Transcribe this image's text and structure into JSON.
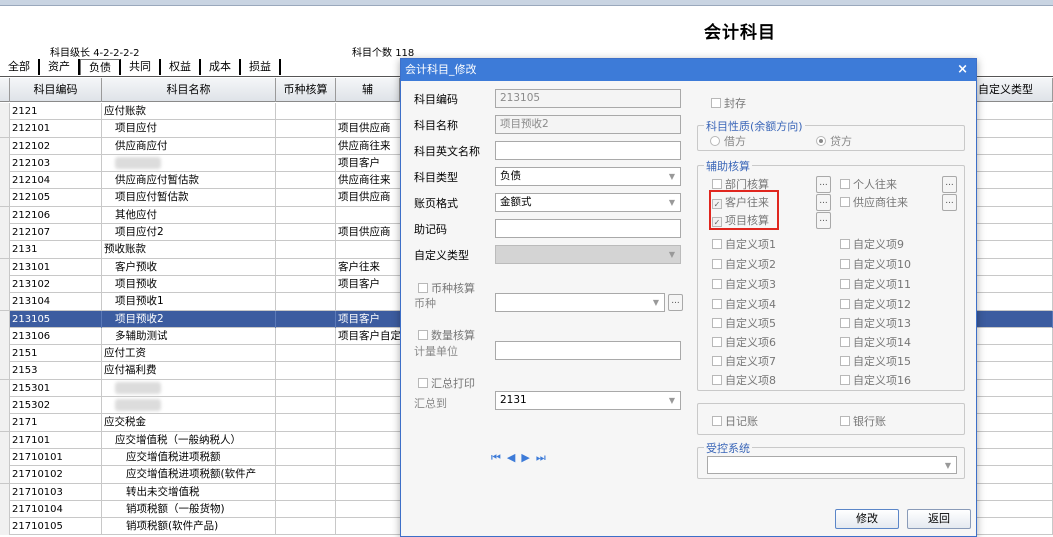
{
  "page": {
    "title": "会计科目",
    "level_label": "科目级长",
    "level_value": "4-2-2-2-2",
    "count_label": "科目个数",
    "count_value": "118"
  },
  "category_tabs": [
    "全部",
    "资产",
    "负债",
    "共同",
    "权益",
    "成本",
    "损益"
  ],
  "active_tab": "负债",
  "grid": {
    "columns": {
      "code": "科目编码",
      "name": "科目名称",
      "currency": "币种核算",
      "aux": "辅",
      "custom_type": "自定义类型"
    },
    "rows": [
      {
        "code": "2121",
        "name": "应付账款",
        "indent": 0,
        "aux": ""
      },
      {
        "code": "212101",
        "name": "项目应付",
        "indent": 1,
        "aux": "项目供应商"
      },
      {
        "code": "212102",
        "name": "供应商应付",
        "indent": 1,
        "aux": "供应商往来"
      },
      {
        "code": "212103",
        "name": "",
        "indent": 1,
        "aux": "项目客户",
        "blur": true
      },
      {
        "code": "212104",
        "name": "供应商应付暂估款",
        "indent": 1,
        "aux": "供应商往来"
      },
      {
        "code": "212105",
        "name": "项目应付暂估款",
        "indent": 1,
        "aux": "项目供应商"
      },
      {
        "code": "212106",
        "name": "其他应付",
        "indent": 1,
        "aux": ""
      },
      {
        "code": "212107",
        "name": "项目应付2",
        "indent": 1,
        "aux": "项目供应商"
      },
      {
        "code": "2131",
        "name": "预收账款",
        "indent": 0,
        "aux": ""
      },
      {
        "code": "213101",
        "name": "客户预收",
        "indent": 1,
        "aux": "客户往来"
      },
      {
        "code": "213102",
        "name": "项目预收",
        "indent": 1,
        "aux": "项目客户"
      },
      {
        "code": "213104",
        "name": "项目预收1",
        "indent": 1,
        "aux": ""
      },
      {
        "code": "213105",
        "name": "项目预收2",
        "indent": 1,
        "aux": "项目客户",
        "selected": true
      },
      {
        "code": "213106",
        "name": "多辅助测试",
        "indent": 1,
        "aux": "项目客户自定"
      },
      {
        "code": "2151",
        "name": "应付工资",
        "indent": 0,
        "aux": ""
      },
      {
        "code": "2153",
        "name": "应付福利费",
        "indent": 0,
        "aux": ""
      },
      {
        "code": "215301",
        "name": "",
        "indent": 1,
        "aux": "",
        "blur": true
      },
      {
        "code": "215302",
        "name": "",
        "indent": 1,
        "aux": "",
        "blur": true
      },
      {
        "code": "2171",
        "name": "应交税金",
        "indent": 0,
        "aux": ""
      },
      {
        "code": "217101",
        "name": "应交增值税（一般纳税人）",
        "indent": 1,
        "aux": ""
      },
      {
        "code": "21710101",
        "name": "应交增值税进项税额",
        "indent": 2,
        "aux": ""
      },
      {
        "code": "21710102",
        "name": "应交增值税进项税额(软件产",
        "indent": 2,
        "aux": ""
      },
      {
        "code": "21710103",
        "name": "转出未交增值税",
        "indent": 2,
        "aux": ""
      },
      {
        "code": "21710104",
        "name": "销项税额（一般货物)",
        "indent": 2,
        "aux": ""
      },
      {
        "code": "21710105",
        "name": "销项税额(软件产品)",
        "indent": 2,
        "aux": ""
      }
    ]
  },
  "dialog": {
    "title": "会计科目_修改",
    "close_icon": "×",
    "fields": {
      "code": {
        "label": "科目编码",
        "value": "213105"
      },
      "name": {
        "label": "科目名称",
        "value": "项目预收2"
      },
      "english_name": {
        "label": "科目英文名称",
        "value": ""
      },
      "type": {
        "label": "科目类型",
        "value": "负债"
      },
      "page_format": {
        "label": "账页格式",
        "value": "金额式"
      },
      "mnemonic": {
        "label": "助记码",
        "value": ""
      },
      "custom_type": {
        "label": "自定义类型",
        "value": ""
      },
      "currency_check": {
        "label": "币种核算"
      },
      "currency": {
        "label": "币种",
        "value": ""
      },
      "quantity_check": {
        "label": "数量核算"
      },
      "unit": {
        "label": "计量单位",
        "value": ""
      },
      "summary_print": {
        "label": "汇总打印"
      },
      "summary_to": {
        "label": "汇总到",
        "value": "2131"
      }
    },
    "sealed": {
      "label": "封存"
    },
    "nature": {
      "title": "科目性质(余额方向)",
      "debit": "借方",
      "credit": "贷方",
      "selected": "贷方"
    },
    "aux": {
      "title": "辅助核算",
      "dept": "部门核算",
      "personal": "个人往来",
      "customer": "客户往来",
      "supplier": "供应商往来",
      "project": "项目核算",
      "custom_left": [
        "自定义项1",
        "自定义项2",
        "自定义项3",
        "自定义项4",
        "自定义项5",
        "自定义项6",
        "自定义项7",
        "自定义项8"
      ],
      "custom_right": [
        "自定义项9",
        "自定义项10",
        "自定义项11",
        "自定义项12",
        "自定义项13",
        "自定义项14",
        "自定义项15",
        "自定义项16"
      ]
    },
    "journal": "日记账",
    "bank": "银行账",
    "controlled_system": {
      "title": "受控系统",
      "value": ""
    },
    "nav": {
      "first": "⏮",
      "prev": "◀",
      "next": "▶",
      "last": "⏭"
    },
    "buttons": {
      "modify": "修改",
      "back": "返回"
    }
  },
  "colors": {
    "selected_row": "#3c5ca0",
    "dialog_title": "#3d7bd8",
    "highlight": "#e0261e"
  }
}
